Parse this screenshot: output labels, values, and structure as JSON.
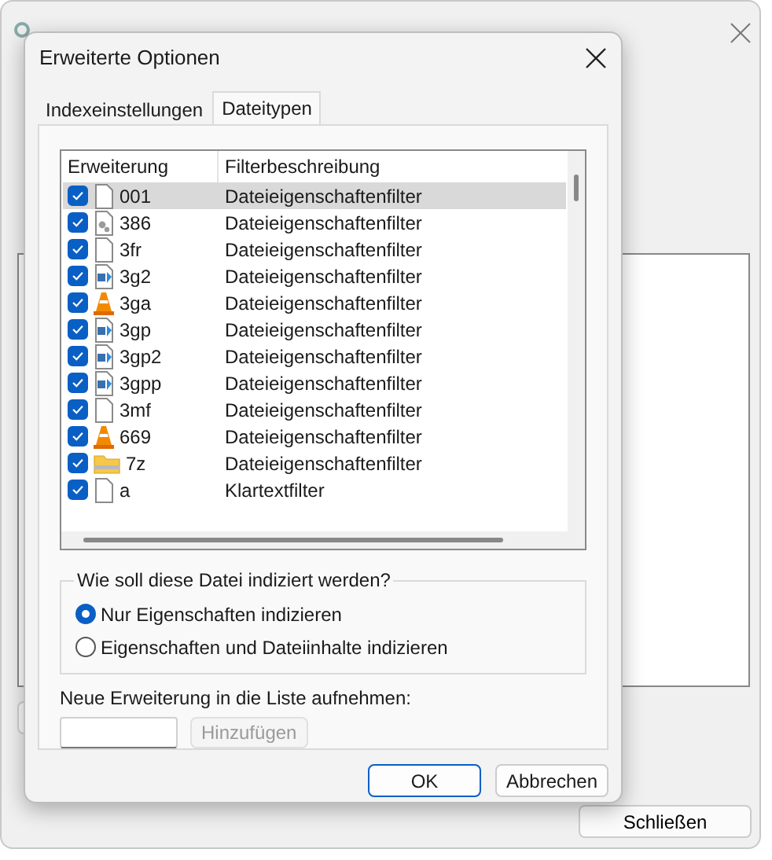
{
  "background_window": {
    "close_button": "Schließen"
  },
  "dialog": {
    "title": "Erweiterte Optionen",
    "tabs": [
      {
        "label": "Indexeinstellungen",
        "selected": false
      },
      {
        "label": "Dateitypen",
        "selected": true
      }
    ],
    "table": {
      "columns": [
        "Erweiterung",
        "Filterbeschreibung"
      ],
      "rows": [
        {
          "extension": "001",
          "filter": "Dateieigenschaftenfilter",
          "kind": "blank",
          "checked": true,
          "selected": true
        },
        {
          "extension": "386",
          "filter": "Dateieigenschaftenfilter",
          "kind": "gear",
          "checked": true,
          "selected": false
        },
        {
          "extension": "3fr",
          "filter": "Dateieigenschaftenfilter",
          "kind": "blank",
          "checked": true,
          "selected": false
        },
        {
          "extension": "3g2",
          "filter": "Dateieigenschaftenfilter",
          "kind": "media",
          "checked": true,
          "selected": false
        },
        {
          "extension": "3ga",
          "filter": "Dateieigenschaftenfilter",
          "kind": "cone",
          "checked": true,
          "selected": false
        },
        {
          "extension": "3gp",
          "filter": "Dateieigenschaftenfilter",
          "kind": "media",
          "checked": true,
          "selected": false
        },
        {
          "extension": "3gp2",
          "filter": "Dateieigenschaftenfilter",
          "kind": "media",
          "checked": true,
          "selected": false
        },
        {
          "extension": "3gpp",
          "filter": "Dateieigenschaftenfilter",
          "kind": "media",
          "checked": true,
          "selected": false
        },
        {
          "extension": "3mf",
          "filter": "Dateieigenschaftenfilter",
          "kind": "blank",
          "checked": true,
          "selected": false
        },
        {
          "extension": "669",
          "filter": "Dateieigenschaftenfilter",
          "kind": "cone",
          "checked": true,
          "selected": false
        },
        {
          "extension": "7z",
          "filter": "Dateieigenschaftenfilter",
          "kind": "archive",
          "checked": true,
          "selected": false
        },
        {
          "extension": "a",
          "filter": "Klartextfilter",
          "kind": "blank",
          "checked": true,
          "selected": false
        }
      ]
    },
    "group": {
      "title": "Wie soll diese Datei indiziert werden?",
      "options": [
        {
          "label": "Nur Eigenschaften indizieren",
          "selected": true
        },
        {
          "label": "Eigenschaften und Dateiinhalte indizieren",
          "selected": false
        }
      ]
    },
    "new_extension": {
      "label": "Neue Erweiterung in die Liste aufnehmen:",
      "add_button": {
        "label": "Hinzufügen",
        "disabled": true
      }
    },
    "buttons": [
      {
        "label": "OK",
        "default": true
      },
      {
        "label": "Abbrechen",
        "default": false
      }
    ]
  }
}
